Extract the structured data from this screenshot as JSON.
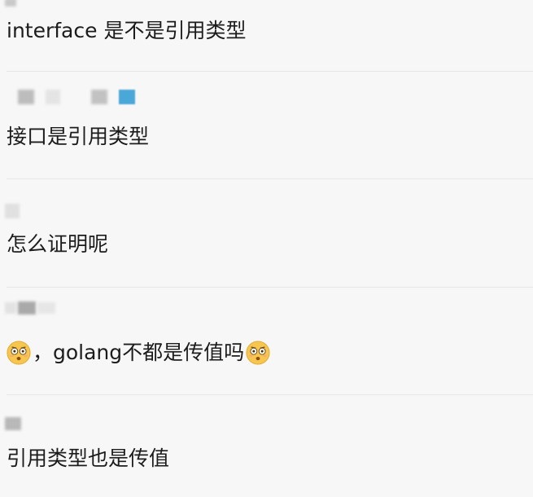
{
  "messages": [
    {
      "text": "interface 是不是引用类型"
    },
    {
      "text": "接口是引用类型"
    },
    {
      "text": "怎么证明呢"
    },
    {
      "text_before": "，golang不都是传值吗",
      "emoji": "flushed-face-icon"
    },
    {
      "text": "引用类型也是传值"
    }
  ],
  "colors": {
    "background": "#f7f7f7",
    "text": "#1c1c1c",
    "divider": "#e6e6e6",
    "avatar_accent": "#4aa8d8",
    "emoji_face": "#f6c64f"
  }
}
